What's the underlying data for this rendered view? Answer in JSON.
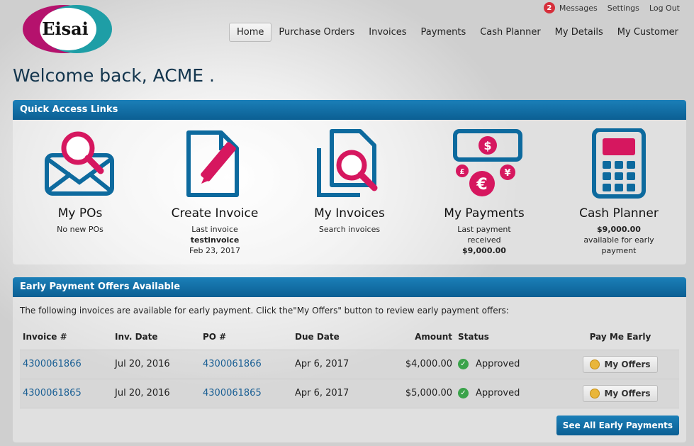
{
  "brand": {
    "logo_text": "Eisai",
    "colors": {
      "magenta": "#b5126d",
      "teal": "#1e9ea6",
      "primary": "#0b5f93",
      "accent_pink": "#d6175f",
      "success": "#3aa34a"
    }
  },
  "topbar": {
    "messages_count": "2",
    "messages": "Messages",
    "settings": "Settings",
    "logout": "Log Out"
  },
  "nav": {
    "items": [
      "Home",
      "Purchase Orders",
      "Invoices",
      "Payments",
      "Cash Planner",
      "My Details",
      "My Customer"
    ],
    "active": "Home"
  },
  "welcome": "Welcome back, ACME .",
  "quick": {
    "title": "Quick Access Links",
    "tiles": [
      {
        "title": "My POs",
        "line1": "No new POs",
        "line2": "",
        "line3": "",
        "icon": "envelope-search-icon"
      },
      {
        "title": "Create Invoice",
        "line1": "Last invoice",
        "line2": "testinvoice",
        "line3": "Feb 23, 2017",
        "icon": "document-pen-icon"
      },
      {
        "title": "My Invoices",
        "line1": "Search invoices",
        "line2": "",
        "line3": "",
        "icon": "document-search-icon"
      },
      {
        "title": "My Payments",
        "line1": "Last payment",
        "line2": "received",
        "line3": "$9,000.00",
        "icon": "money-currency-icon"
      },
      {
        "title": "Cash Planner",
        "line1": "$9,000.00",
        "line2": "available for early",
        "line3": "payment",
        "icon": "calculator-icon"
      }
    ]
  },
  "early": {
    "title": "Early Payment Offers Available",
    "intro": "The following invoices are available for early payment. Click the\"My Offers\" button to review early payment offers:",
    "columns": [
      "Invoice #",
      "Inv. Date",
      "PO #",
      "Due Date",
      "Amount",
      "Status",
      "Pay Me Early"
    ],
    "rows": [
      {
        "invoice": "4300061866",
        "inv_date": "Jul 20, 2016",
        "po": "4300061866",
        "due": "Apr 6, 2017",
        "amount": "$4,000.00",
        "status": "Approved",
        "action": "My Offers"
      },
      {
        "invoice": "4300061865",
        "inv_date": "Jul 20, 2016",
        "po": "4300061865",
        "due": "Apr 6, 2017",
        "amount": "$5,000.00",
        "status": "Approved",
        "action": "My Offers"
      }
    ],
    "see_all": "See All Early Payments"
  }
}
